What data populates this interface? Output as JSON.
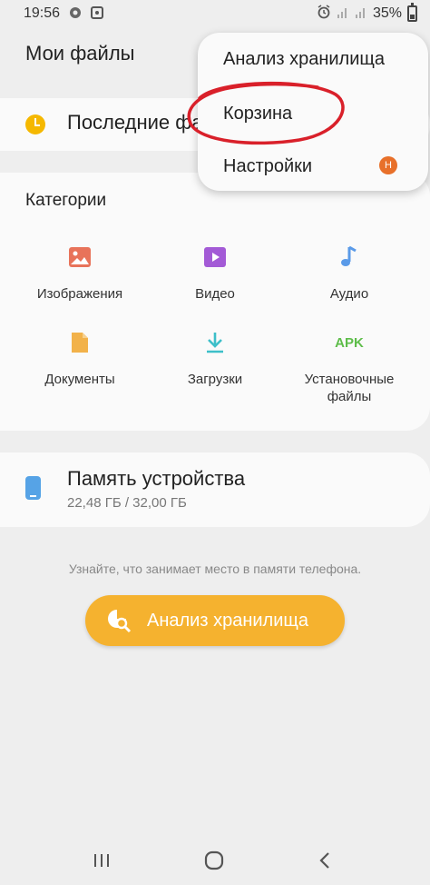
{
  "status_bar": {
    "time": "19:56",
    "battery_percent": "35%",
    "left_icons": [
      "settings-circle-icon",
      "photo-notification-icon"
    ],
    "right_icons": [
      "alarm-icon",
      "signal-icon",
      "signal-icon",
      "battery-icon"
    ]
  },
  "header": {
    "title": "Мои файлы"
  },
  "recent": {
    "label": "Последние файлы"
  },
  "categories": {
    "title": "Категории",
    "items": [
      {
        "label": "Изображения",
        "icon": "image-icon",
        "color": "#e8735a"
      },
      {
        "label": "Видео",
        "icon": "video-icon",
        "color": "#a35ad6"
      },
      {
        "label": "Аудио",
        "icon": "music-icon",
        "color": "#5a9ae8"
      },
      {
        "label": "Документы",
        "icon": "document-icon",
        "color": "#f2b24a"
      },
      {
        "label": "Загрузки",
        "icon": "download-icon",
        "color": "#3dbfc9"
      },
      {
        "label": "Установочные файлы",
        "line1": "Установочные",
        "line2": "файлы",
        "icon_text": "APK",
        "color": "#5ebd4a"
      }
    ]
  },
  "memory": {
    "title": "Память устройства",
    "usage": "22,48 ГБ / 32,00 ГБ"
  },
  "hint": "Узнайте, что занимает место в памяти телефона.",
  "analyze_button": {
    "label": "Анализ хранилища",
    "color": "#f5b22f"
  },
  "menu": {
    "items": [
      {
        "label": "Анализ хранилища"
      },
      {
        "label": "Корзина"
      },
      {
        "label": "Настройки"
      }
    ],
    "badge": "Н",
    "badge_color": "#e8702a",
    "annotation_color": "#d9202a"
  },
  "nav_bar": {
    "icons": [
      "recent-apps-icon",
      "home-icon",
      "back-icon"
    ]
  }
}
